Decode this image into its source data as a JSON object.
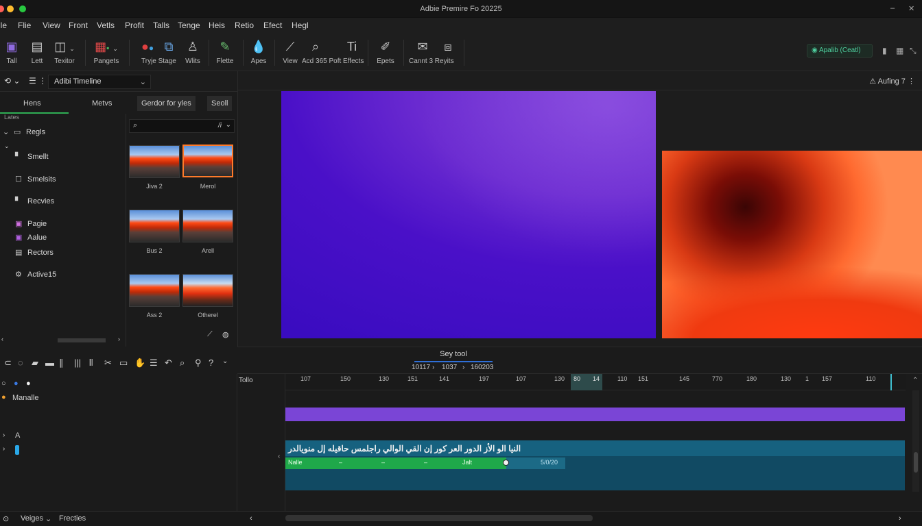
{
  "window": {
    "title": "Adbie Premire Fo 20225"
  },
  "menu": [
    "ile",
    "Flie",
    "View",
    "Front",
    "Vetls",
    "Profit",
    "Talls",
    "Tenge",
    "Heis",
    "Retio",
    "Efect",
    "Hegl"
  ],
  "toolbar": {
    "tools": [
      {
        "label": "Tall",
        "icon": "select-icon"
      },
      {
        "label": "Lett",
        "icon": "document-icon"
      },
      {
        "label": "Texitor",
        "icon": "frame-icon"
      },
      {
        "label": "Pangets",
        "icon": "color-swatches-icon"
      },
      {
        "label": "Tryje Stage",
        "icon": "palette-icon"
      },
      {
        "label": "",
        "icon": "frame-tag-icon"
      },
      {
        "label": "Wlits",
        "icon": "person-icon"
      },
      {
        "label": "Flette",
        "icon": "pen-ruler-icon"
      },
      {
        "label": "Apes",
        "icon": "drop-icon"
      },
      {
        "label": "View",
        "icon": "wand-icon"
      },
      {
        "label": "Acd 365 Poft Effects",
        "icon": "search-icon"
      },
      {
        "label": "",
        "icon": "text-tool-icon"
      },
      {
        "label": "Epets",
        "icon": "pencil-icon"
      },
      {
        "label": "Cannt 3 Reyits",
        "icon": "envelope-icon"
      },
      {
        "label": "",
        "icon": "layers-icon"
      }
    ],
    "workspace_badge": "Apalib (Ceatl)"
  },
  "left_panel": {
    "dropdown_value": "Adibi Timeline",
    "tabs": [
      "Hens",
      "Metvs"
    ],
    "pills": [
      "Gerdor for yles",
      "Seoll"
    ],
    "section_label": "Lates",
    "tree": [
      {
        "label": "Regls",
        "icon": "folder-icon"
      },
      {
        "label": "Smellt",
        "icon": "file-icon"
      },
      {
        "label": "Smelsits",
        "icon": "checkbox-icon"
      },
      {
        "label": "Recvies",
        "icon": "file-icon"
      },
      {
        "label": "Pagie",
        "icon": "color-swatch-icon"
      },
      {
        "label": "Aalue",
        "icon": "color-swatch-icon"
      },
      {
        "label": "Rectors",
        "icon": "list-icon"
      },
      {
        "label": "Active15",
        "icon": "gear-icon"
      }
    ],
    "search_suffix": "/i",
    "media": [
      {
        "caption": "Jiva 2"
      },
      {
        "caption": "Merol"
      },
      {
        "caption": "Bus 2"
      },
      {
        "caption": "Arell"
      },
      {
        "caption": "Ass 2"
      },
      {
        "caption": "Otherel"
      }
    ]
  },
  "viewer": {
    "header_right": "Aufing 7"
  },
  "timeline": {
    "tab_label": "Sey tool",
    "timecodes": [
      "10117",
      "1037",
      "160203"
    ],
    "label_col": "Tollo",
    "ruler": [
      "107",
      "150",
      "130",
      "151",
      "141",
      "197",
      "107",
      "130",
      "80",
      "14",
      "110",
      "151",
      "145",
      "770",
      "180",
      "130",
      "1",
      "157",
      "110"
    ],
    "track_head": {
      "row1_label": "Manalle",
      "row_a": "A"
    },
    "audio_text": "النيا الو الأز الدور العر كور إن القي الوالي راجلمس حاقيله إل منويالدر",
    "audio_green_labels": [
      "Nalle",
      "–",
      "–",
      "–",
      "Jalt"
    ],
    "audio_mid_label": "5/0/20"
  },
  "bottom": {
    "left_items": [
      "Veiges",
      "Frecties"
    ]
  }
}
